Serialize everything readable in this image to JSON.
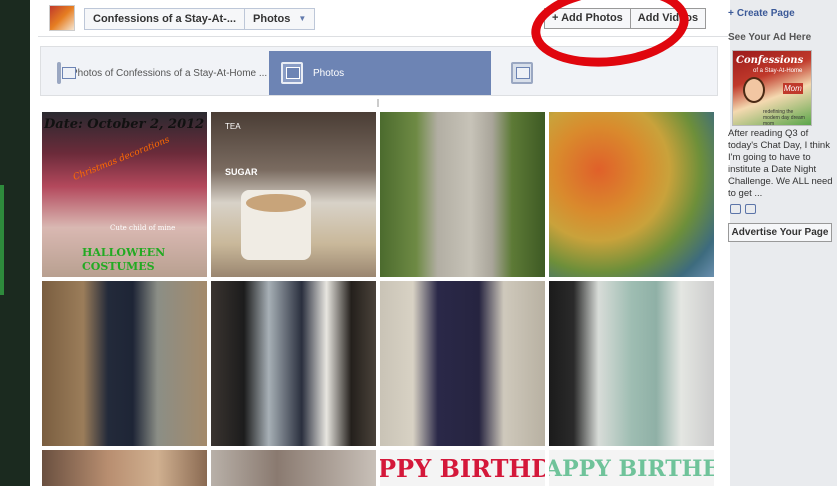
{
  "header": {
    "page_title": "Confessions of a Stay-At-...",
    "section": "Photos",
    "add_photos": "+ Add Photos",
    "add_videos": "Add Videos"
  },
  "tabs": [
    {
      "label": "Photos of Confessions of a Stay-At-Home ..."
    },
    {
      "label": "Photos"
    },
    {
      "label": ""
    }
  ],
  "photos": [
    {
      "caption": "Date: October 2, 2012",
      "sub1": "Christmas decorations",
      "sub2": "Cute child of mine",
      "sub3": "HALLOWEEN",
      "sub4": "COSTUMES"
    },
    {
      "caption": "SUGAR",
      "sub1": "TEA"
    },
    {
      "caption": ""
    },
    {
      "caption": ""
    },
    {
      "caption": ""
    },
    {
      "caption": ""
    },
    {
      "caption": ""
    },
    {
      "caption": ""
    },
    {
      "caption": ""
    },
    {
      "caption": ""
    },
    {
      "caption": "PPY BIRTHD"
    },
    {
      "caption": "APPY BIRTHE"
    }
  ],
  "sidebar": {
    "create_page": "Create Page",
    "ad_heading": "See Your Ad Here",
    "ad_image_title": "Confessions",
    "ad_image_sub": "of a Stay-At-Home",
    "ad_image_mom": "Mom",
    "ad_image_tag": "redefining the modern day dream mom",
    "ad_text": "After reading Q3 of today's Chat Day, I think I'm going to have to institute a Date Night Challenge. We ALL need to get ...",
    "advertise": "Advertise Your Page"
  },
  "colors": {
    "accent": "#6d84b4",
    "link": "#3b5998",
    "annotation": "#e0060e"
  }
}
